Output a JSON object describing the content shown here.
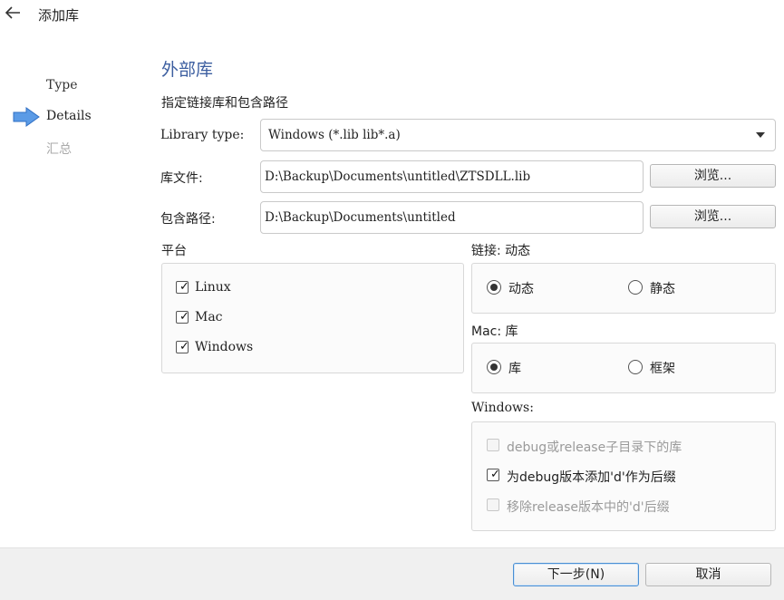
{
  "window": {
    "title": "添加库"
  },
  "steps": [
    {
      "label": "Type"
    },
    {
      "label": "Details"
    },
    {
      "label": "汇总"
    }
  ],
  "page": {
    "heading": "外部库",
    "subheading": "指定链接库和包含路径"
  },
  "form": {
    "library_type_label": "Library type:",
    "library_type_value": "Windows (*.lib lib*.a)",
    "library_file_label": "库文件:",
    "library_file_value": "D:\\Backup\\Documents\\untitled\\ZTSDLL.lib",
    "include_path_label": "包含路径:",
    "include_path_value": "D:\\Backup\\Documents\\untitled",
    "browse_label": "浏览..."
  },
  "platform": {
    "title": "平台",
    "options": [
      {
        "label": "Linux",
        "checked": true
      },
      {
        "label": "Mac",
        "checked": true
      },
      {
        "label": "Windows",
        "checked": true
      }
    ]
  },
  "linkage": {
    "title": "链接: 动态",
    "options": [
      {
        "label": "动态",
        "selected": true
      },
      {
        "label": "静态",
        "selected": false
      }
    ]
  },
  "mac": {
    "title": "Mac: 库",
    "options": [
      {
        "label": "库",
        "selected": true
      },
      {
        "label": "框架",
        "selected": false
      }
    ]
  },
  "windows": {
    "title": "Windows:",
    "options": [
      {
        "label": "debug或release子目录下的库",
        "checked": false,
        "enabled": false
      },
      {
        "label": "为debug版本添加'd'作为后缀",
        "checked": true,
        "enabled": true
      },
      {
        "label": "移除release版本中的'd'后缀",
        "checked": false,
        "enabled": false
      }
    ]
  },
  "footer": {
    "next_label": "下一步(N)",
    "cancel_label": "取消"
  },
  "colors": {
    "accent": "#3c5ea0",
    "step_arrow": "#4a90e2",
    "default_button_border": "#4a8fd4"
  }
}
